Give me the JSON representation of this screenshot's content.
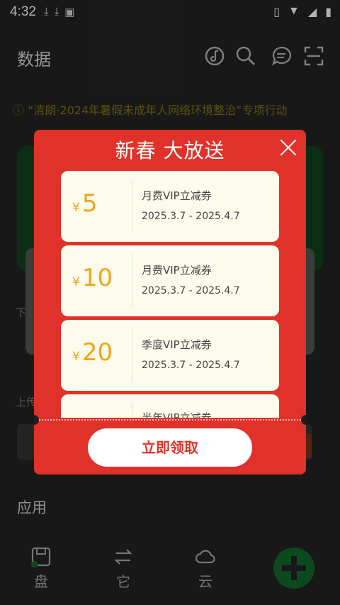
{
  "status_bar": {
    "time": "4:32"
  },
  "header": {
    "title": "数据"
  },
  "notice": {
    "text": "ⓘ “清朗·2024年暑假未成年人网络环境整治”专项行动"
  },
  "background": {
    "row1_label": "下",
    "row2_label": "上传",
    "section_title": "应用"
  },
  "bottom_nav": [
    {
      "label": "盘",
      "icon": "save-disk-icon"
    },
    {
      "label": "它",
      "icon": "transfer-icon"
    },
    {
      "label": "云",
      "icon": "cloud-icon"
    }
  ],
  "popup": {
    "title": "新春 大放送",
    "coupons": [
      {
        "currency": "¥",
        "amount": "5",
        "name": "月费VIP立减券",
        "validity": "2025.3.7 - 2025.4.7"
      },
      {
        "currency": "¥",
        "amount": "10",
        "name": "月费VIP立减券",
        "validity": "2025.3.7 - 2025.4.7"
      },
      {
        "currency": "¥",
        "amount": "20",
        "name": "季度VIP立减券",
        "validity": "2025.3.7 - 2025.4.7"
      },
      {
        "currency": "",
        "amount": "",
        "name": "半年VIP立减券",
        "validity": ""
      }
    ],
    "claim_label": "立即领取"
  },
  "colors": {
    "popup_red": "#e0322a",
    "coupon_bg": "#fdfbec",
    "amount_orange": "#f2a516",
    "accent_green": "#0f5a26"
  }
}
